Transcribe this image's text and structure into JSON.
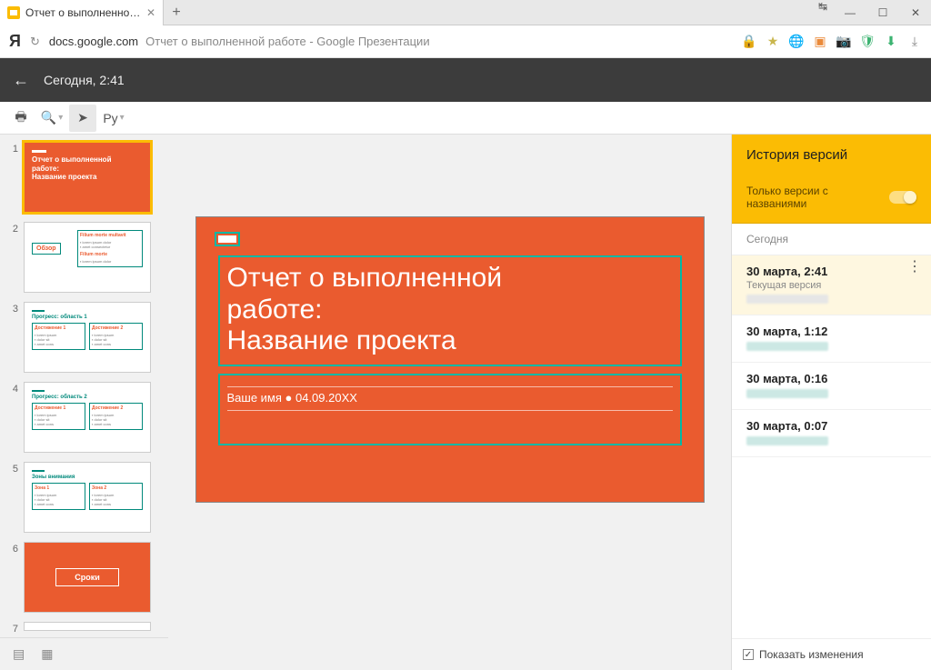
{
  "browser": {
    "tab_title": "Отчет о выполненной ра",
    "domain": "docs.google.com",
    "page_title": "Отчет о выполненной работе - Google Презентации"
  },
  "app": {
    "back_label": "Сегодня, 2:41",
    "cursor_label": "Ру"
  },
  "slide": {
    "title_l1": "Отчет о выполненной",
    "title_l2": "работе:",
    "title_l3": "Название проекта",
    "subtitle": "Ваше имя ● 04.09.20XX"
  },
  "thumbs": {
    "t1_l1": "Отчет о выполненной",
    "t1_l2": "работе:",
    "t1_l3": "Название проекта",
    "t2_label": "Обзор",
    "t3_label": "Прогресс: область 1",
    "t4_label": "Прогресс: область 2",
    "t5_label": "Зоны внимания",
    "t6_label": "Сроки",
    "col_a": "Достижение 1",
    "col_b": "Достижение 2",
    "zone_a": "Зона 1",
    "zone_b": "Зона 2"
  },
  "history": {
    "panel_title": "История версий",
    "toggle_label": "Только версии с названиями",
    "day": "Сегодня",
    "items": [
      {
        "time": "30 марта, 2:41",
        "sub": "Текущая версия",
        "current": true
      },
      {
        "time": "30 марта, 1:12"
      },
      {
        "time": "30 марта, 0:16"
      },
      {
        "time": "30 марта, 0:07"
      }
    ],
    "show_changes": "Показать изменения"
  }
}
